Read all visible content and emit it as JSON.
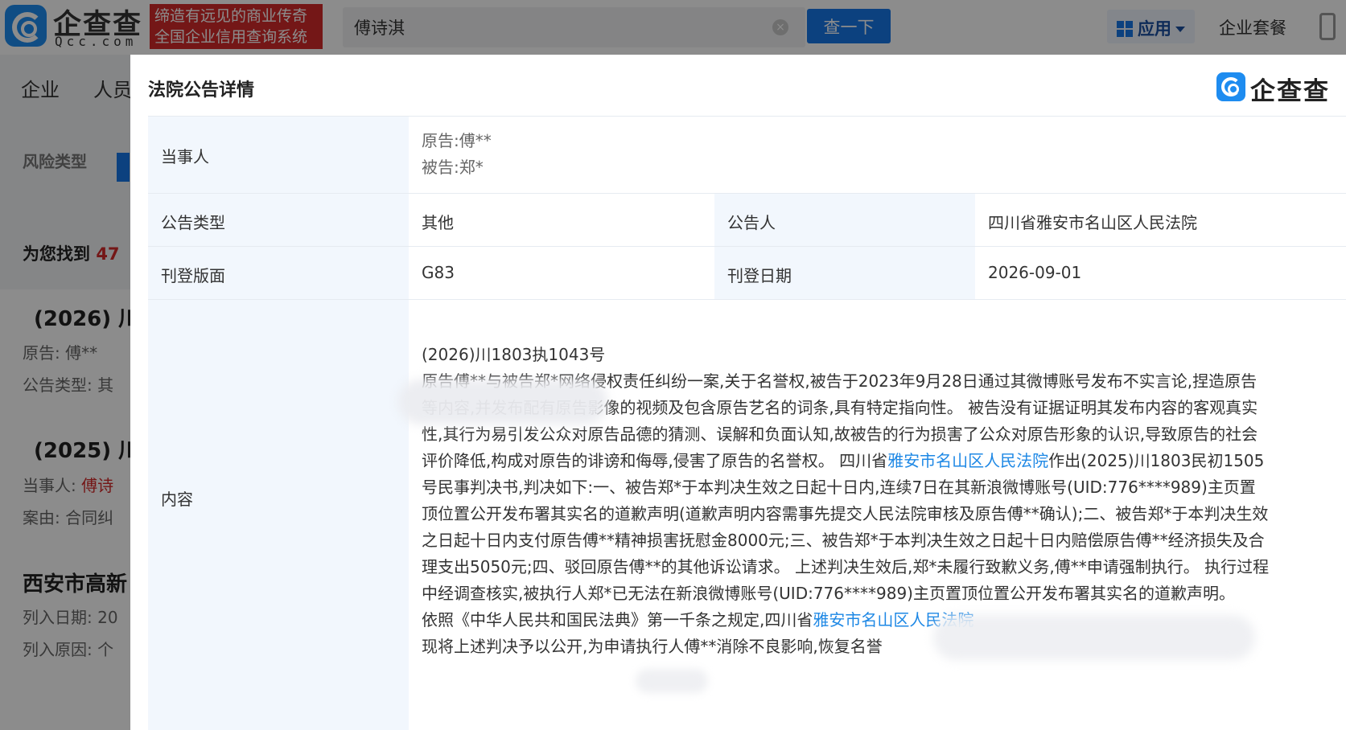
{
  "header": {
    "logo_text": "企查查",
    "logo_sub": "Qcc.com",
    "slogan_line1": "缔造有远见的商业传奇",
    "slogan_line2": "全国企业信用查询系统",
    "search_value": "傅诗淇",
    "search_button": "查一下",
    "apps_label": "应用",
    "package_link": "企业套餐"
  },
  "background": {
    "nav": [
      "企业",
      "人员"
    ],
    "risk_type_label": "风险类型",
    "found_prefix": "为您找到",
    "found_count": "47",
    "result1_title": "(2026) 川",
    "result1_plaintiff_label": "原告:",
    "result1_plaintiff": "傅**",
    "result1_type_label": "公告类型:",
    "result1_type": "其",
    "result2_title": "(2025) 川",
    "result2_party_label": "当事人:",
    "result2_party": "傅诗",
    "result2_cause_label": "案由:",
    "result2_cause": "合同纠",
    "result3_title": "西安市高新",
    "result3_date_label": "列入日期:",
    "result3_date": "20",
    "result3_reason_label": "列入原因:",
    "result3_reason": "个"
  },
  "modal": {
    "title": "法院公告详情",
    "logo_text": "企查查",
    "parties_label": "当事人",
    "plaintiff": "原告:傅**",
    "defendant": "被告:郑*",
    "type_label": "公告类型",
    "type_value": "其他",
    "announcer_label": "公告人",
    "announcer_value": "四川省雅安市名山区人民法院",
    "page_label": "刊登版面",
    "page_value": "G83",
    "date_label": "刊登日期",
    "date_value": "2026-09-01",
    "content_label": "内容",
    "content": {
      "case_no": "(2026)川1803执1043号",
      "p1": "原告傅**与被告郑*网络侵权责任纠纷一案,关于名誉权,被告于2023年9月28日通过其微博账号发布不实言论,捏造原告",
      "p2": "等内容,并发布配有原告影像的视频及包含原告艺名的词条,具有特定指向性。 被告没有证据证明其发布内容的客观真实性,其行为易引发公众对原告品德的猜测、误解和负面认知,故被告的行为损害了公众对原告形象的认识,导致原告的社会评价降低,构成对原告的诽谤和侮辱,侵害了原告的名誉权。 四川省",
      "link1": "雅安市名山区人民法院",
      "p3": "作出(2025)川1803民初1505号民事判决书,判决如下:一、被告郑*于本判决生效之日起十日内,连续7日在其新浪微博账号(UID:776****989)主页置顶位置公开发布署其实名的道歉声明(道歉声明内容需事先提交人民法院审核及原告傅**确认);二、被告郑*于本判决生效之日起十日内支付原告傅**精神损害抚慰金8000元;三、被告郑*于本判决生效之日起十日内赔偿原告傅**经济损失及合理支出5050元;四、驳回原告傅**的其他诉讼请求。 上述判决生效后,郑*未履行致歉义务,傅**申请强制执行。 执行过程中经调查核实,被执行人郑*已无法在新浪微博账号(UID:776****989)主页置顶位置公开发布署其实名的道歉声明。",
      "p4_prefix": "依照《中华人民共和国民法典》第一千条之规定,四川省",
      "link2": "雅安市名山区人民法院",
      "p5": "现将上述判决予以公开,为申请执行人傅**消除不良影响,恢复名誉"
    }
  },
  "colors": {
    "brand_blue": "#1677e8",
    "slogan_red": "#d42a2a",
    "link_blue": "#1e88e5",
    "label_bg": "#f2f7fd"
  }
}
